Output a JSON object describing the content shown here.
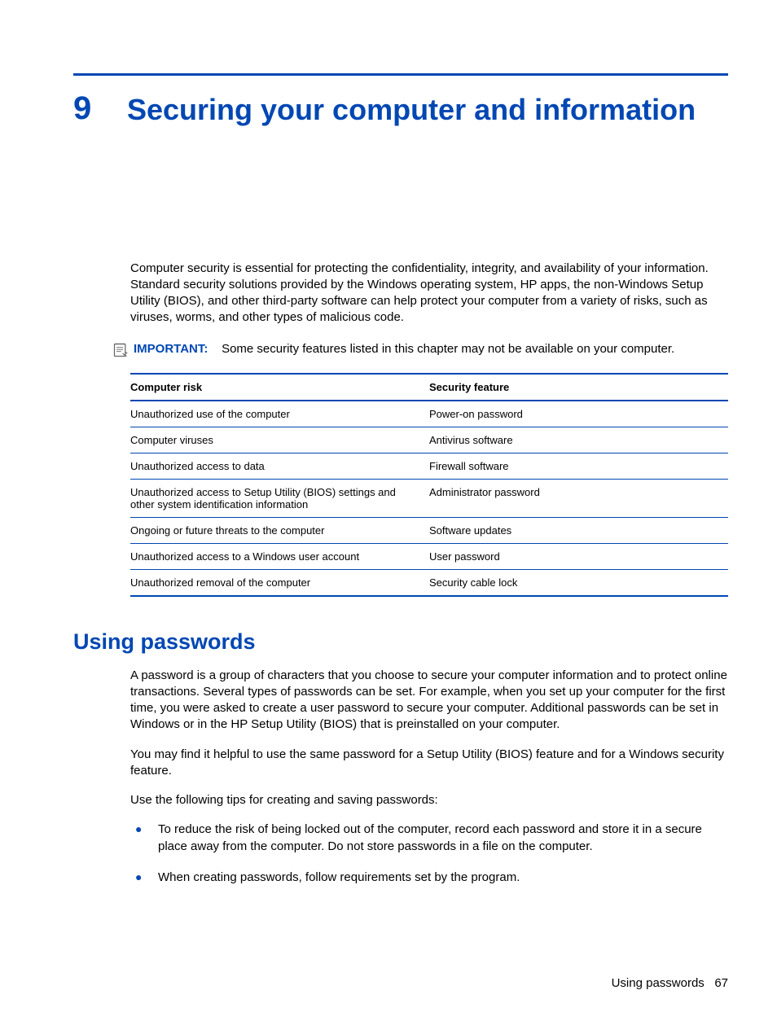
{
  "chapter": {
    "number": "9",
    "title": "Securing your computer and information"
  },
  "intro": "Computer security is essential for protecting the confidentiality, integrity, and availability of your information. Standard security solutions provided by the Windows operating system, HP apps, the non-Windows Setup Utility (BIOS), and other third-party software can help protect your computer from a variety of risks, such as viruses, worms, and other types of malicious code.",
  "important": {
    "label": "IMPORTANT:",
    "text": "Some security features listed in this chapter may not be available on your computer."
  },
  "table": {
    "headers": [
      "Computer risk",
      "Security feature"
    ],
    "rows": [
      [
        "Unauthorized use of the computer",
        "Power-on password"
      ],
      [
        "Computer viruses",
        "Antivirus software"
      ],
      [
        "Unauthorized access to data",
        "Firewall software"
      ],
      [
        "Unauthorized access to Setup Utility (BIOS) settings and other system identification information",
        "Administrator password"
      ],
      [
        "Ongoing or future threats to the computer",
        "Software updates"
      ],
      [
        "Unauthorized access to a Windows user account",
        "User password"
      ],
      [
        "Unauthorized removal of the computer",
        "Security cable lock"
      ]
    ]
  },
  "section": {
    "heading": "Using passwords",
    "para1": "A password is a group of characters that you choose to secure your computer information and to protect online transactions. Several types of passwords can be set. For example, when you set up your computer for the first time, you were asked to create a user password to secure your computer. Additional passwords can be set in Windows or in the HP Setup Utility (BIOS) that is preinstalled on your computer.",
    "para2": "You may find it helpful to use the same password for a Setup Utility (BIOS) feature and for a Windows security feature.",
    "para3": "Use the following tips for creating and saving passwords:",
    "tips": [
      "To reduce the risk of being locked out of the computer, record each password and store it in a secure place away from the computer. Do not store passwords in a file on the computer.",
      "When creating passwords, follow requirements set by the program."
    ]
  },
  "footer": {
    "section": "Using passwords",
    "page": "67"
  }
}
